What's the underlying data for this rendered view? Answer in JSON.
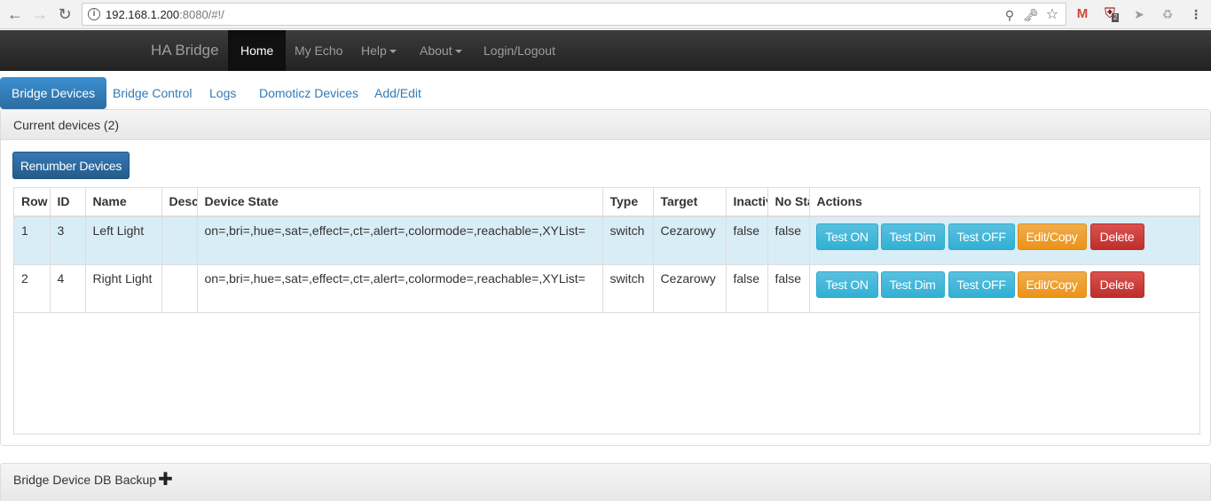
{
  "browser": {
    "url_host": "192.168.1.200",
    "url_rest": ":8080/#!/",
    "ext_badge": "2"
  },
  "navbar": {
    "brand": "HA Bridge",
    "items": [
      {
        "label": "Home"
      },
      {
        "label": "My Echo"
      },
      {
        "label": "Help"
      },
      {
        "label": "About"
      },
      {
        "label": "Login/Logout"
      }
    ]
  },
  "tabs": [
    {
      "label": "Bridge Devices"
    },
    {
      "label": "Bridge Control"
    },
    {
      "label": "Logs"
    },
    {
      "label": "Domoticz Devices"
    },
    {
      "label": "Add/Edit"
    }
  ],
  "devices_panel": {
    "title": "Current devices (2)",
    "renumber_label": "Renumber Devices",
    "columns": [
      "Row",
      "ID",
      "Name",
      "Description",
      "Device State",
      "Type",
      "Target",
      "Inactive",
      "No State",
      "Actions"
    ],
    "rows": [
      {
        "row": "1",
        "id": "3",
        "name": "Left Light",
        "description": "",
        "state": "on=,bri=,hue=,sat=,effect=,ct=,alert=,colormode=,reachable=,XYList=",
        "type": "switch",
        "target": "Cezarowy",
        "inactive": "false",
        "nostate": "false"
      },
      {
        "row": "2",
        "id": "4",
        "name": "Right Light",
        "description": "",
        "state": "on=,bri=,hue=,sat=,effect=,ct=,alert=,colormode=,reachable=,XYList=",
        "type": "switch",
        "target": "Cezarowy",
        "inactive": "false",
        "nostate": "false"
      }
    ],
    "actions": {
      "test_on": "Test ON",
      "test_dim": "Test Dim",
      "test_off": "Test OFF",
      "edit_copy": "Edit/Copy",
      "delete": "Delete"
    }
  },
  "backup_panel": {
    "title": "Bridge Device DB Backup"
  },
  "colors": {
    "primary": "#337ab7",
    "info": "#5bc0de",
    "warning": "#f0ad4e",
    "danger": "#d9534f",
    "selected_row": "#d9edf7"
  }
}
